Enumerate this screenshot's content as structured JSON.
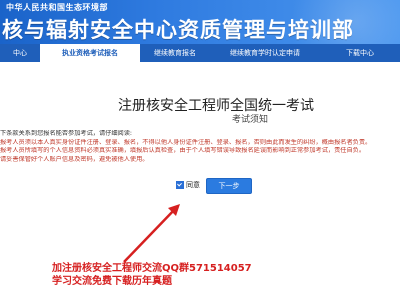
{
  "header": {
    "subtitle": "中华人民共和国生态环境部",
    "title": "核与辐射安全中心资质管理与培训部"
  },
  "nav": {
    "items": [
      {
        "label": "中心",
        "active": false
      },
      {
        "label": "执业资格考试报名",
        "active": true
      },
      {
        "label": "继续教育报名",
        "active": false
      },
      {
        "label": "继续教育学时认定申请",
        "active": false
      },
      {
        "label": "下载中心",
        "active": false
      }
    ]
  },
  "main": {
    "title": "注册核安全工程师全国统一考试",
    "subtitle": "考试须知",
    "notice_intro": "下条款关系到您报名能否参加考试，请仔细阅读:",
    "notice_lines": [
      "报考人员须以本人真实身份证件注册、登录、报名，不得以他人身份证件注册、登录、报名，否则由此而发生的纠纷，概由报名者负责。",
      "报考人员所填写的个人信息资料必须真实准确，填报后认真检查，由于个人填写错误导致报名延误而影响到正常参加考试，责任自负。",
      "请妥善保管好个人账户信息及密码，避免被他人使用。"
    ],
    "agree_label": "同意",
    "agree_checked": true,
    "next_label": "下一步"
  },
  "promo": {
    "line1": "加注册核安全工程师交流QQ群571514057",
    "line2": "学习交流免费下载历年真题"
  },
  "colors": {
    "header_blue": "#2f7be0",
    "nav_blue": "#1f5fba",
    "notice_red": "#c0392b",
    "promo_red": "#d62020",
    "button_blue": "#2b7be0"
  }
}
